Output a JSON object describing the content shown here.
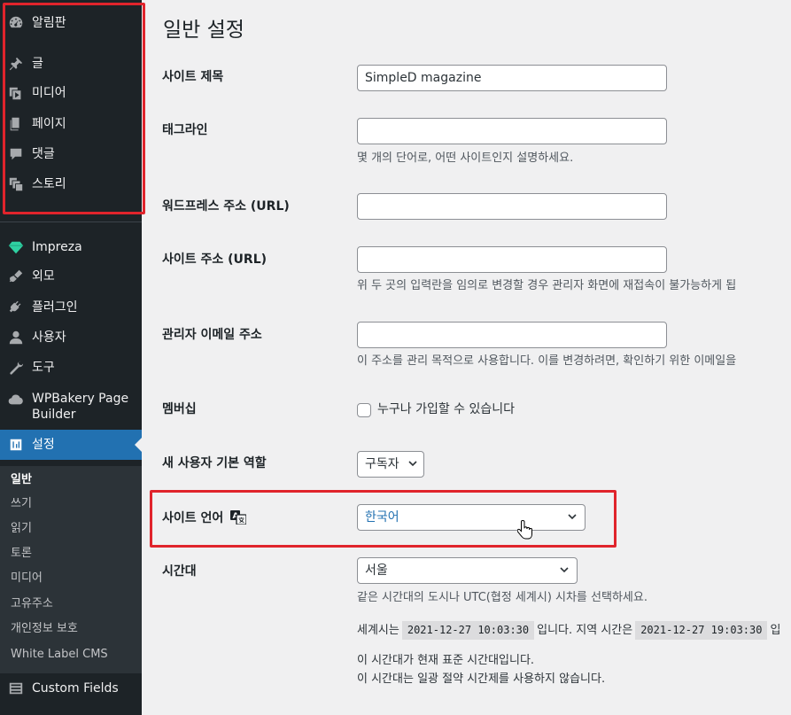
{
  "sidebar": {
    "items": [
      {
        "label": "알림판",
        "icon": "dashboard-icon"
      },
      {
        "label": "글",
        "icon": "pin-icon"
      },
      {
        "label": "미디어",
        "icon": "media-icon"
      },
      {
        "label": "페이지",
        "icon": "pages-icon"
      },
      {
        "label": "댓글",
        "icon": "comments-icon"
      },
      {
        "label": "스토리",
        "icon": "stories-icon"
      },
      {
        "label": "Impreza",
        "icon": "diamond-icon"
      },
      {
        "label": "외모",
        "icon": "appearance-icon"
      },
      {
        "label": "플러그인",
        "icon": "plugins-icon"
      },
      {
        "label": "사용자",
        "icon": "users-icon"
      },
      {
        "label": "도구",
        "icon": "tools-icon"
      },
      {
        "label": "WPBakery Page",
        "label2": "Builder",
        "icon": "cloud-icon"
      },
      {
        "label": "설정",
        "icon": "settings-icon"
      }
    ],
    "submenu": [
      "일반",
      "쓰기",
      "읽기",
      "토론",
      "미디어",
      "고유주소",
      "개인정보 보호",
      "White Label CMS"
    ],
    "custom_fields": "Custom Fields"
  },
  "main": {
    "title": "일반 설정",
    "site_title_label": "사이트 제목",
    "site_title_value": "SimpleD magazine",
    "tagline_label": "태그라인",
    "tagline_value": "",
    "tagline_desc": "몇 개의 단어로, 어떤 사이트인지 설명하세요.",
    "wp_address_label": "워드프레스 주소 (URL)",
    "wp_address_value": "",
    "site_address_label": "사이트 주소 (URL)",
    "site_address_value": "",
    "site_address_desc": "위 두 곳의 입력란을 임의로 변경할 경우 관리자 화면에 재접속이 불가능하게 됩",
    "admin_email_label": "관리자 이메일 주소",
    "admin_email_value": "",
    "admin_email_desc": "이 주소를 관리 목적으로 사용합니다. 이를 변경하려면, 확인하기 위한 이메일을",
    "membership_label": "멤버십",
    "membership_option": "누구나 가입할 수 있습니다",
    "membership_checked": false,
    "default_role_label": "새 사용자 기본 역할",
    "default_role_value": "구독자",
    "site_language_label": "사이트 언어",
    "site_language_value": "한국어",
    "timezone_label": "시간대",
    "timezone_value": "서울",
    "timezone_desc": "같은 시간대의 도시나 UTC(협정 세계시) 시차를 선택하세요.",
    "utc_prefix": "세계시는",
    "utc_time": "2021-12-27 10:03:30",
    "utc_suffix": "입니다. 지역 시간은",
    "local_time": "2021-12-27 19:03:30",
    "local_suffix": "입",
    "tz_note1": "이 시간대가 현재 표준 시간대입니다.",
    "tz_note2": "이 시간대는 일광 절약 시간제를 사용하지 않습니다."
  },
  "colors": {
    "sidebar_bg": "#1d2327",
    "active_bg": "#2271b1",
    "highlight_red": "#e0242c",
    "link_blue": "#2271b1"
  }
}
